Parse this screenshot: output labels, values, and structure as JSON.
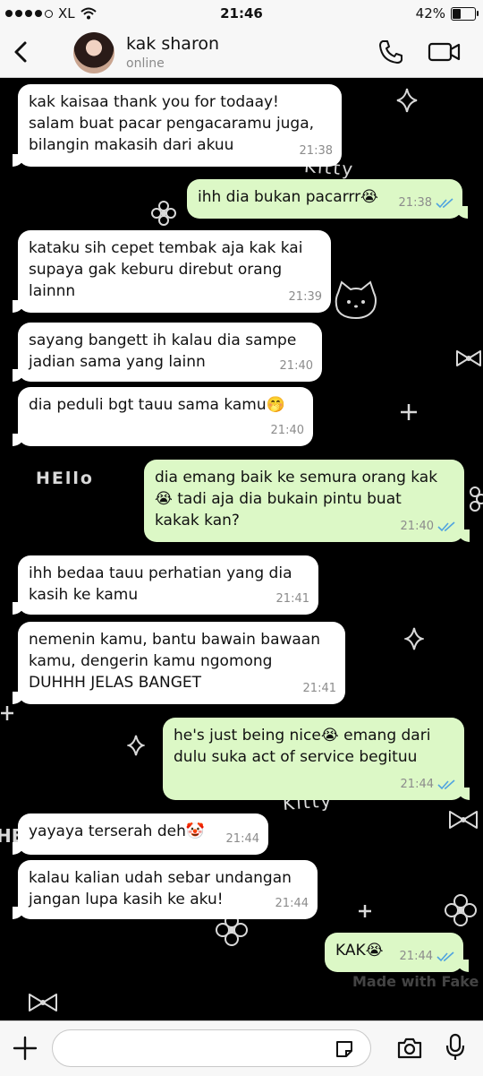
{
  "status_bar": {
    "carrier": "XL",
    "time": "21:46",
    "battery_percent": "42%",
    "battery_level": 0.42,
    "signal_bars": 4
  },
  "header": {
    "contact_name": "kak sharon",
    "contact_status": "online",
    "icons": [
      "back-chevron-icon",
      "avatar",
      "phone-icon",
      "video-camera-icon"
    ]
  },
  "background_doodles": [
    "Kitty",
    "HEllo",
    "Kitty",
    "HE"
  ],
  "messages": [
    {
      "direction": "in",
      "text": "kak kaisaa thank you for todaay!\nsalam buat pacar pengacaramu juga,\nbilangin makasih dari akuu",
      "time": "21:38"
    },
    {
      "direction": "out",
      "text": "ihh dia bukan pacarrr😭",
      "time": "21:38",
      "read": true
    },
    {
      "direction": "in",
      "text": "kataku sih cepet tembak aja kak kai\nsupaya gak keburu direbut orang\nlainnn",
      "time": "21:39"
    },
    {
      "direction": "in",
      "text": "sayang bangett ih kalau dia sampe\njadian sama yang lainn",
      "time": "21:40"
    },
    {
      "direction": "in",
      "text": "dia peduli bgt tauu sama kamu🤭",
      "time": "21:40"
    },
    {
      "direction": "out",
      "text": "dia emang baik ke semura orang kak\n😭 tadi aja dia bukain pintu buat\nkakak kan?",
      "time": "21:40",
      "read": true
    },
    {
      "direction": "in",
      "text": "ihh bedaa tauu perhatian yang dia\nkasih ke kamu",
      "time": "21:41"
    },
    {
      "direction": "in",
      "text": "nemenin kamu, bantu bawain bawaan\nkamu, dengerin kamu ngomong\nDUHHH JELAS BANGET",
      "time": "21:41"
    },
    {
      "direction": "out",
      "text": "he's just being nice😭 emang dari\ndulu suka act of service begituu",
      "time": "21:44",
      "read": true
    },
    {
      "direction": "in",
      "text": "yayaya terserah deh🤡",
      "time": "21:44"
    },
    {
      "direction": "in",
      "text": "kalau kalian udah sebar undangan\njangan lupa kasih ke aku!",
      "time": "21:44"
    },
    {
      "direction": "out",
      "text": "KAK😭",
      "time": "21:44",
      "read": true
    }
  ],
  "watermark": "Made with Fake",
  "input_bar": {
    "placeholder": "",
    "icons": [
      "plus-icon",
      "sticker-icon",
      "camera-icon",
      "microphone-icon"
    ]
  }
}
